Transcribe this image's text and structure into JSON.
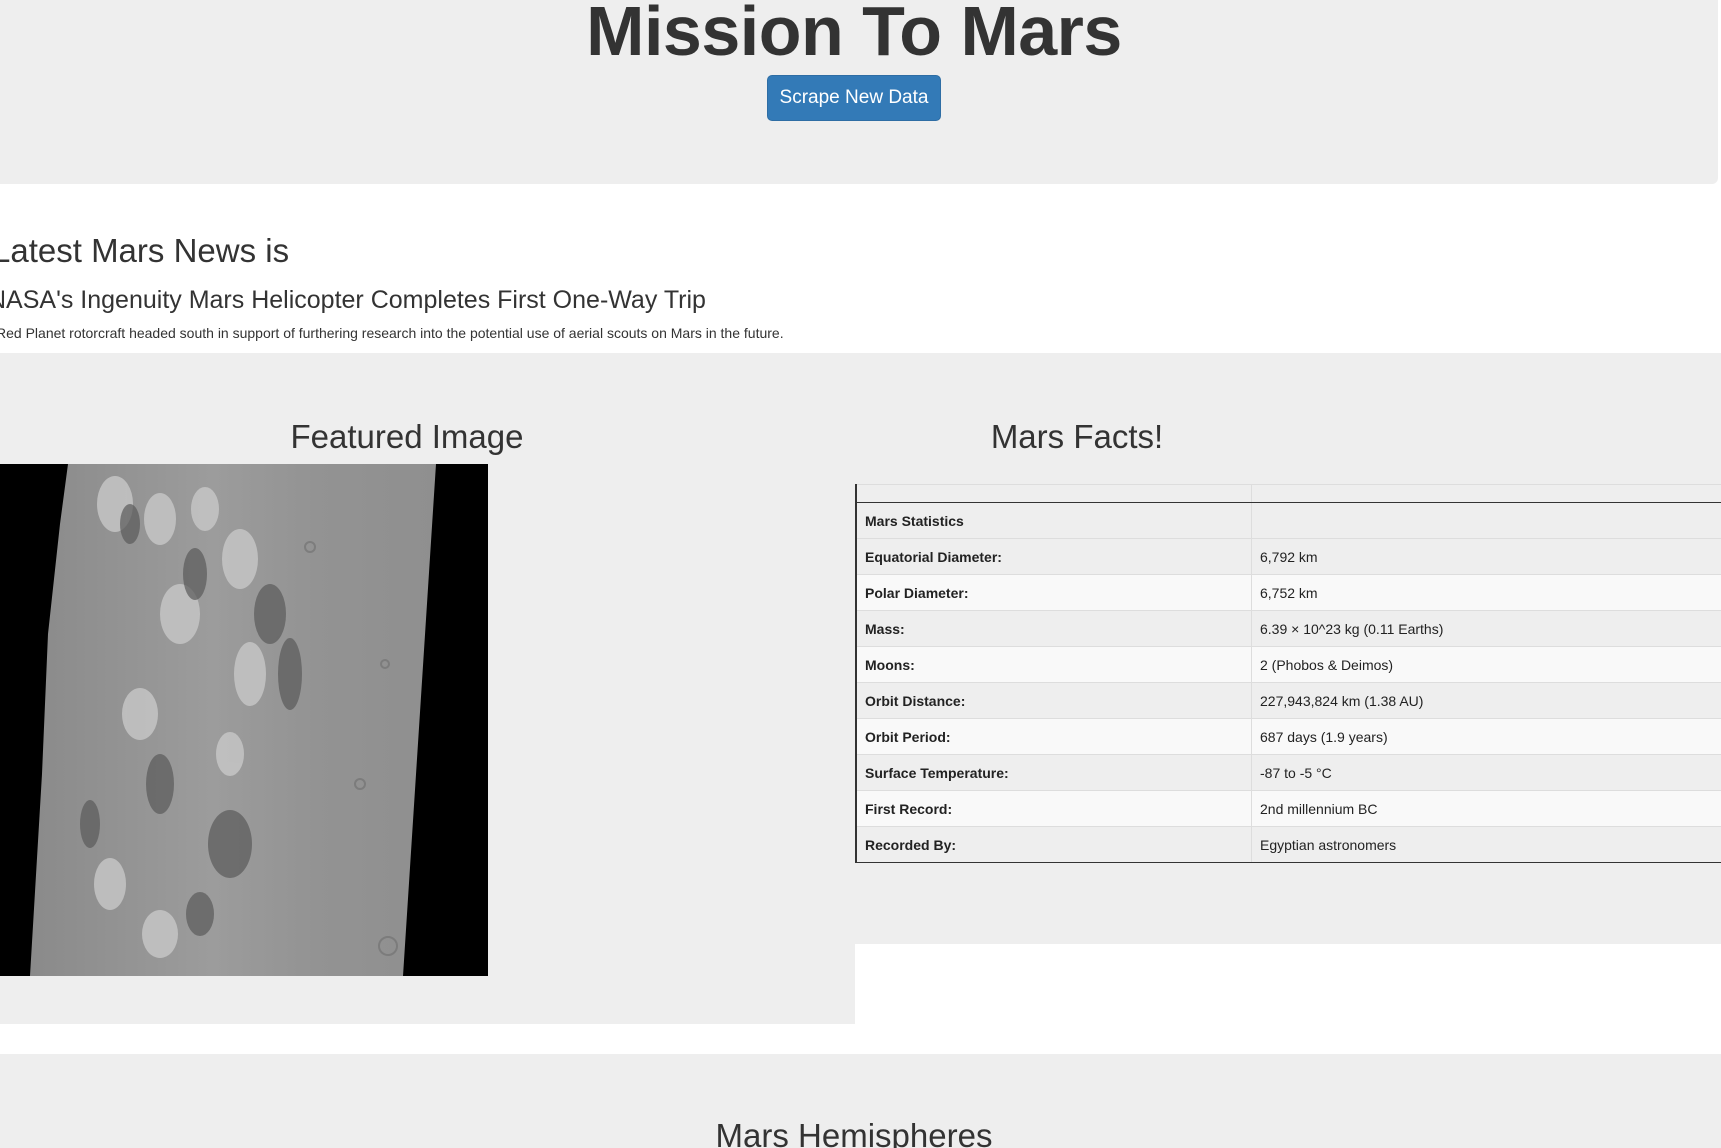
{
  "header": {
    "title": "Mission To Mars",
    "scrape_button_label": "Scrape New Data"
  },
  "news": {
    "heading": "Latest Mars News is",
    "title": "NASA's Ingenuity Mars Helicopter Completes First One-Way Trip",
    "teaser": "The Red Planet rotorcraft headed south in support of furthering research into the potential use of aerial scouts on Mars in the future."
  },
  "featured": {
    "heading": "Featured Image"
  },
  "facts": {
    "heading": "Mars Facts!",
    "stats_header": "Mars Statistics",
    "rows": [
      {
        "label": "Equatorial Diameter:",
        "value": "6,792 km"
      },
      {
        "label": "Polar Diameter:",
        "value": "6,752 km"
      },
      {
        "label": "Mass:",
        "value": "6.39 × 10^23 kg (0.11 Earths)"
      },
      {
        "label": "Moons:",
        "value": "2 (Phobos & Deimos)"
      },
      {
        "label": "Orbit Distance:",
        "value": "227,943,824 km (1.38 AU)"
      },
      {
        "label": "Orbit Period:",
        "value": "687 days (1.9 years)"
      },
      {
        "label": "Surface Temperature:",
        "value": "-87 to -5 °C"
      },
      {
        "label": "First Record:",
        "value": "2nd millennium BC"
      },
      {
        "label": "Recorded By:",
        "value": "Egyptian astronomers"
      }
    ]
  },
  "hemispheres": {
    "heading": "Mars Hemispheres"
  },
  "colors": {
    "button": "#337ab7",
    "band": "#eeeeee",
    "text": "#333333"
  }
}
